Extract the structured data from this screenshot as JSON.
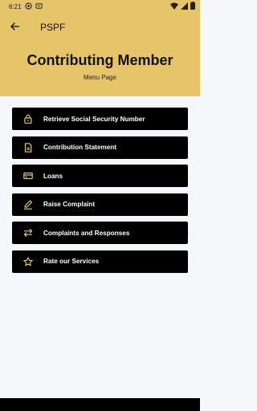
{
  "status": {
    "time": "6:21"
  },
  "app_bar": {
    "title": "PSPF"
  },
  "header": {
    "title": "Contributing Member",
    "subtitle": "Menu Page"
  },
  "menu": [
    {
      "label": "Retrieve Social Security Number",
      "icon": "lock-icon"
    },
    {
      "label": "Contribution Statement",
      "icon": "document-icon"
    },
    {
      "label": "Loans",
      "icon": "card-icon"
    },
    {
      "label": "Raise Complaint",
      "icon": "pencil-icon"
    },
    {
      "label": "Complaints and Responses",
      "icon": "swap-arrows-icon"
    },
    {
      "label": "Rate our Services",
      "icon": "star-icon"
    }
  ],
  "colors": {
    "header": "#e6c46a",
    "icon_accent": "#e6c46a",
    "button": "#000000",
    "background": "#f6f7fb"
  }
}
